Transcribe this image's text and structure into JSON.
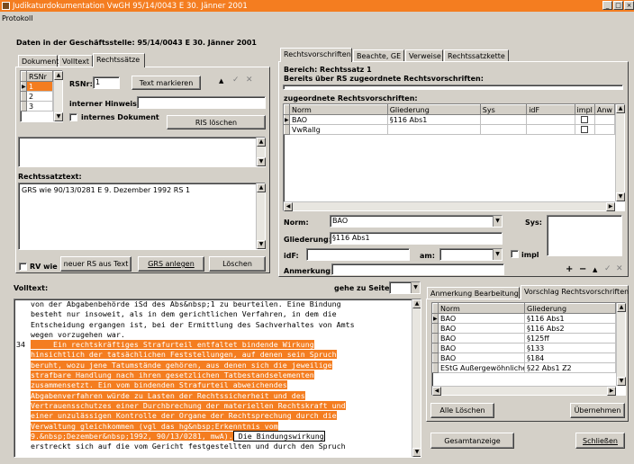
{
  "window": {
    "title": "Judikaturdokumentation VwGH 95/14/0043 E 30. Jänner 2001",
    "menu": "Protokoll",
    "minimize": "_",
    "maximize": "□",
    "close": "×"
  },
  "header": "Daten in der Geschäftsstelle: 95/14/0043 E 30. Jänner 2001",
  "left_tabs": [
    "Dokument",
    "Volltext",
    "Rechtssätze"
  ],
  "rs_table": {
    "header": "RSNr",
    "rows": [
      "1",
      "2",
      "3"
    ]
  },
  "rsnr": {
    "label": "RSNr:",
    "value": "1"
  },
  "text_markieren": "Text markieren",
  "interner_hinweis": {
    "label": "interner Hinweis:",
    "value": ""
  },
  "internes_dokument": "internes Dokument",
  "ris_loeschen": "RIS löschen",
  "rechtssatztext": {
    "label": "Rechtssatztext:",
    "value": "GRS wie 90/13/0281 E 9. Dezember 1992 RS 1"
  },
  "rv_wie": "RV wie",
  "buttons": {
    "neuer_rs": "neuer RS aus Text",
    "grs_anlegen": "GRS anlegen",
    "loeschen": "Löschen",
    "alle_loeschen": "Alle Löschen",
    "uebernehmen": "Übernehmen",
    "gesamtanzeige": "Gesamtanzeige",
    "schliessen": "Schließen"
  },
  "right_tabs": [
    "Rechtsvorschriften",
    "Beachte, GE",
    "Verweise",
    "Rechtssatzkette"
  ],
  "bereich": "Bereich: Rechtssatz 1",
  "bereits": "Bereits über RS zugeordnete Rechtsvorschriften:",
  "zugeordnete": "zugeordnete Rechtsvorschriften:",
  "rv_table": {
    "headers": [
      "Norm",
      "Gliederung",
      "Sys",
      "idF",
      "impl",
      "Anw"
    ],
    "rows": [
      {
        "norm": "BAO",
        "gliederung": "§116 Abs1"
      },
      {
        "norm": "VwRallg",
        "gliederung": ""
      }
    ]
  },
  "form": {
    "norm_label": "Norm:",
    "norm_value": "BAO",
    "sys_label": "Sys:",
    "gliederung_label": "Gliederung:",
    "gliederung_value": "§116 Abs1",
    "idf_label": "idF:",
    "am_label": "am:",
    "impl_label": "impl",
    "anmerkung_label": "Anmerkung:"
  },
  "volltext": {
    "label": "Volltext:",
    "gehe_label": "gehe zu Seite:",
    "lines": [
      {
        "num": "",
        "text": "von der Abgabenbehörde iSd des Abs&nbsp;1 zu beurteilen. Eine Bindung",
        "hl": false
      },
      {
        "num": "",
        "text": "besteht nur insoweit, als in dem gerichtlichen Verfahren, in dem die",
        "hl": false
      },
      {
        "num": "",
        "text": "Entscheidung ergangen ist, bei der Ermittlung des Sachverhaltes von Amts",
        "hl": false
      },
      {
        "num": "",
        "text": "wegen vorzugehen war.",
        "hl": false
      },
      {
        "num": "34",
        "text": "     Ein rechtskräftiges Strafurteil entfaltet bindende Wirkung",
        "hl": true
      },
      {
        "num": "",
        "text": "hinsichtlich der tatsächlichen Feststellungen, auf denen sein Spruch",
        "hl": true
      },
      {
        "num": "",
        "text": "beruht, wozu jene Tatumstände gehören, aus denen sich die jeweilige",
        "hl": true
      },
      {
        "num": "",
        "text": "strafbare Handlung nach ihren gesetzlichen Tatbestandselementen",
        "hl": true
      },
      {
        "num": "",
        "text": "zusammensetzt. Ein vom bindenden Strafurteil abweichendes",
        "hl": true
      },
      {
        "num": "",
        "text": "Abgabenverfahren würde zu Lasten der Rechtssicherheit und des",
        "hl": true
      },
      {
        "num": "",
        "text": "Vertrauensschutzes einer Durchbrechung der materiellen Rechtskraft und",
        "hl": true
      },
      {
        "num": "",
        "text": "einer unzulässigen Kontrolle der Organe der Rechtsprechung durch die",
        "hl": true
      },
      {
        "num": "",
        "text": "Verwaltung gleichkommen (vgl das hg&nbsp;Erkenntnis vom",
        "hl": true
      }
    ],
    "last_hl": "9.&nbsp;Dezember&nbsp;1992, 90/13/0281, mwA).",
    "last_rest": " Die Bindungswirkung",
    "cutoff": "erstreckt sich auf die vom Gericht festgestellten und durch den Spruch"
  },
  "bottom_tabs": [
    "Anmerkung Bearbeitung",
    "Vorschlag Rechtsvorschriften"
  ],
  "vorschlag": {
    "headers": [
      "Norm",
      "Gliederung"
    ],
    "rows": [
      {
        "norm": "BAO",
        "gliederung": "§116 Abs1"
      },
      {
        "norm": "BAO",
        "gliederung": "§116 Abs2"
      },
      {
        "norm": "BAO",
        "gliederung": "§125ff"
      },
      {
        "norm": "BAO",
        "gliederung": "§133"
      },
      {
        "norm": "BAO",
        "gliederung": "§184"
      },
      {
        "norm": "EStG Außergewöhnliche Bel",
        "gliederung": "§22 Abs1 Z2"
      }
    ]
  }
}
